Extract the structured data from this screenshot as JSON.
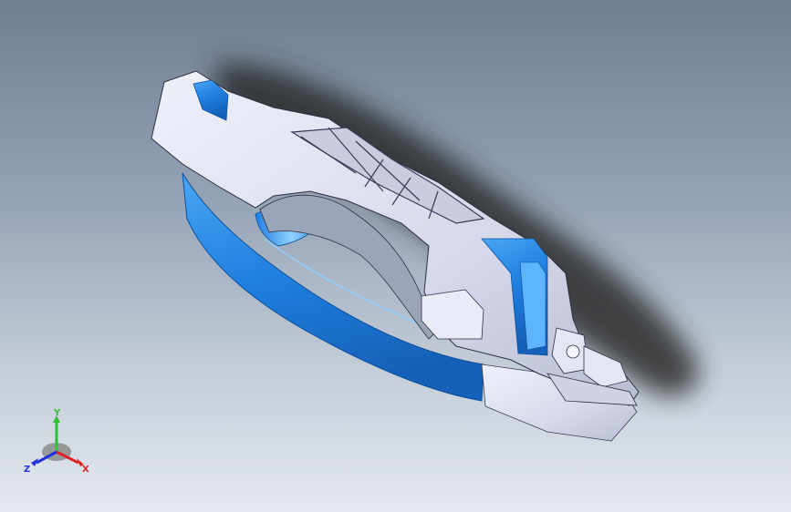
{
  "viewport": {
    "background_top": "#6f7f93",
    "background_bottom": "#e4e8ee"
  },
  "model": {
    "icon": "door-handle-assembly-3d",
    "body_color": "#dcdff0",
    "handle_color": "#1f7fe0",
    "shadow_color": "#2a2a2a"
  },
  "triad": {
    "x_label": "X",
    "y_label": "Y",
    "z_label": "Z",
    "x_color": "#e02020",
    "y_color": "#30c030",
    "z_color": "#2030e0"
  }
}
